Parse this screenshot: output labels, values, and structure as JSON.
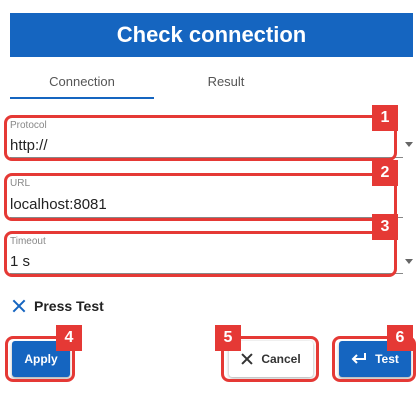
{
  "dialog": {
    "title": "Check connection"
  },
  "tabs": [
    {
      "label": "Connection",
      "active": true
    },
    {
      "label": "Result",
      "active": false
    }
  ],
  "fields": {
    "protocol": {
      "label": "Protocol",
      "value": "http://"
    },
    "url": {
      "label": "URL",
      "value": "localhost:8081"
    },
    "timeout": {
      "label": "Timeout",
      "value": "1 s"
    }
  },
  "status": {
    "icon": "close-icon",
    "text": "Press Test"
  },
  "buttons": {
    "apply": "Apply",
    "cancel": "Cancel",
    "test": "Test"
  },
  "callouts": [
    "1",
    "2",
    "3",
    "4",
    "5",
    "6"
  ],
  "colors": {
    "primary": "#1565c0",
    "callout": "#e53935"
  }
}
